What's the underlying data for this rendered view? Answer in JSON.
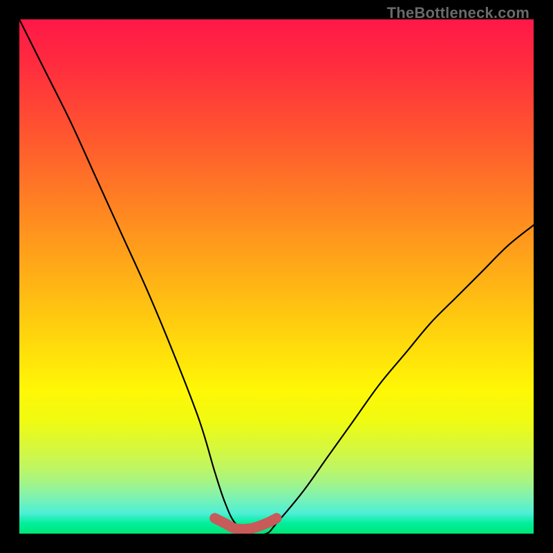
{
  "watermark": "TheBottleneck.com",
  "chart_data": {
    "type": "line",
    "title": "",
    "xlabel": "",
    "ylabel": "",
    "xlim": [
      0,
      100
    ],
    "ylim": [
      0,
      100
    ],
    "series": [
      {
        "name": "bottleneck-curve",
        "x": [
          0,
          5,
          10,
          15,
          20,
          25,
          30,
          35,
          38,
          40,
          42,
          45,
          48,
          50,
          55,
          60,
          65,
          70,
          75,
          80,
          85,
          90,
          95,
          100
        ],
        "values": [
          100,
          90,
          80,
          69,
          58,
          47,
          35,
          22,
          12,
          6,
          2,
          0,
          0,
          2,
          8,
          15,
          22,
          29,
          35,
          41,
          46,
          51,
          56,
          60
        ]
      },
      {
        "name": "optimal-flat-segment",
        "x": [
          38,
          40,
          42,
          45,
          48,
          50
        ],
        "values": [
          3,
          2,
          1,
          1,
          2,
          3
        ]
      }
    ],
    "annotations": []
  },
  "colors": {
    "curve": "#000000",
    "flat_segment": "#c85a5a",
    "background_top": "#ff1848",
    "background_bottom": "#00e676",
    "frame": "#000000"
  }
}
